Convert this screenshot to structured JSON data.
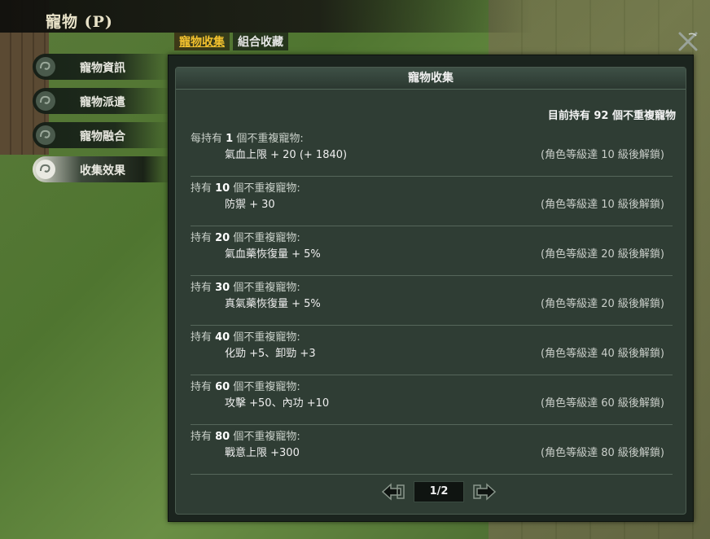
{
  "window": {
    "title": "寵物 (P)"
  },
  "tabs": [
    {
      "label": "寵物收集",
      "active": true
    },
    {
      "label": "組合收藏",
      "active": false
    }
  ],
  "sidebar": {
    "items": [
      {
        "label": "寵物資訊",
        "active": false
      },
      {
        "label": "寵物派遣",
        "active": false
      },
      {
        "label": "寵物融合",
        "active": false
      },
      {
        "label": "收集效果",
        "active": true
      }
    ]
  },
  "panel": {
    "header": "寵物收集",
    "owned_text": "目前持有 92 個不重複寵物",
    "rows": [
      {
        "prefix": "每持有 ",
        "count": "1",
        "suffix": " 個不重複寵物:",
        "effect": "氣血上限 + 20 (+ 1840)",
        "unlock": "(角色等級達 10 級後解鎖)"
      },
      {
        "prefix": "持有 ",
        "count": "10",
        "suffix": " 個不重複寵物:",
        "effect": "防禦 + 30",
        "unlock": "(角色等級達 10 級後解鎖)"
      },
      {
        "prefix": "持有 ",
        "count": "20",
        "suffix": " 個不重複寵物:",
        "effect": "氣血藥恢復量 + 5%",
        "unlock": "(角色等級達 20 級後解鎖)"
      },
      {
        "prefix": "持有 ",
        "count": "30",
        "suffix": " 個不重複寵物:",
        "effect": "真氣藥恢復量 + 5%",
        "unlock": "(角色等級達 20 級後解鎖)"
      },
      {
        "prefix": "持有 ",
        "count": "40",
        "suffix": " 個不重複寵物:",
        "effect": "化勁 +5、卸勁 +3",
        "unlock": "(角色等級達 40 級後解鎖)"
      },
      {
        "prefix": "持有 ",
        "count": "60",
        "suffix": " 個不重複寵物:",
        "effect": "攻擊 +50、內功 +10",
        "unlock": "(角色等級達 60 級後解鎖)"
      },
      {
        "prefix": "持有 ",
        "count": "80",
        "suffix": " 個不重複寵物:",
        "effect": "戰意上限 +300",
        "unlock": "(角色等級達 80 級後解鎖)"
      }
    ]
  },
  "pager": {
    "page": "1/2"
  },
  "icons": {
    "close": "close-icon",
    "prev": "prev-page-icon",
    "next": "next-page-icon",
    "swirl": "cloud-swirl-icon"
  },
  "colors": {
    "active_tab": "#f2c12e",
    "panel_bg": "#2f3d34"
  }
}
